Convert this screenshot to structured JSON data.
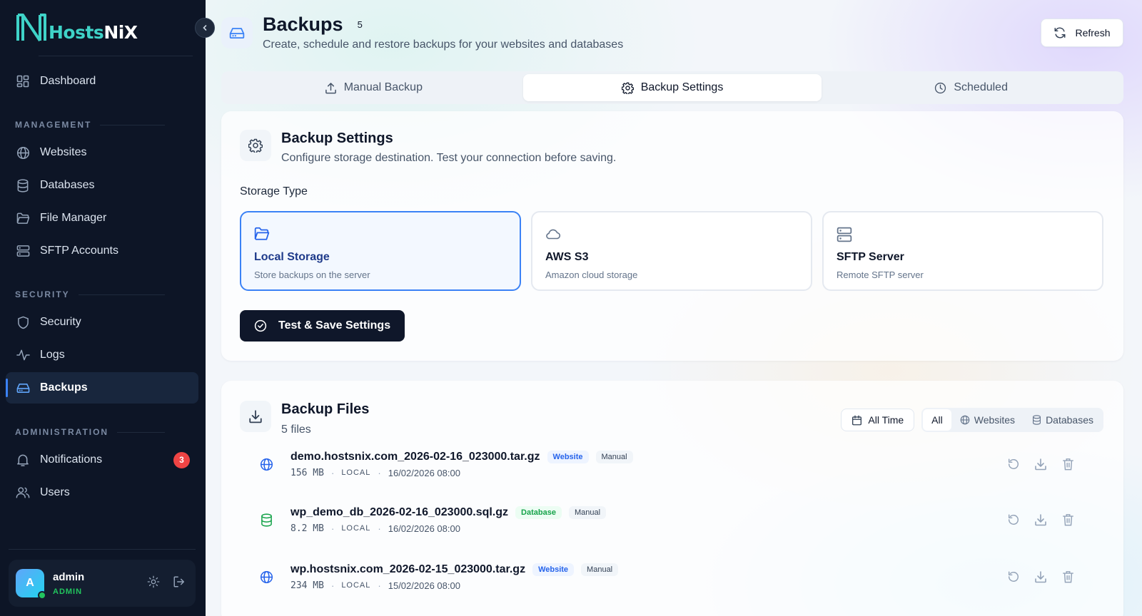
{
  "brand": {
    "name_part1": "Hosts",
    "name_part2": "NiX"
  },
  "sidebar": {
    "dashboard": {
      "label": "Dashboard"
    },
    "sections": {
      "management": "MANAGEMENT",
      "security": "SECURITY",
      "administration": "ADMINISTRATION"
    },
    "items": {
      "websites": "Websites",
      "databases": "Databases",
      "file_manager": "File Manager",
      "sftp_accounts": "SFTP Accounts",
      "security": "Security",
      "logs": "Logs",
      "backups": "Backups",
      "notifications": "Notifications",
      "users": "Users"
    },
    "notifications_count": "3",
    "user": {
      "initial": "A",
      "name": "admin",
      "role": "ADMIN"
    }
  },
  "header": {
    "title": "Backups",
    "count": "5",
    "subtitle": "Create, schedule and restore backups for your websites and databases",
    "refresh_label": "Refresh"
  },
  "tabs": {
    "manual": "Manual Backup",
    "settings": "Backup Settings",
    "scheduled": "Scheduled",
    "active": "settings"
  },
  "settings_card": {
    "title": "Backup Settings",
    "description": "Configure storage destination. Test your connection before saving.",
    "storage_type_label": "Storage Type",
    "options": [
      {
        "title": "Local Storage",
        "desc": "Store backups on the server",
        "icon": "folder-open-icon",
        "selected": true
      },
      {
        "title": "AWS S3",
        "desc": "Amazon cloud storage",
        "icon": "cloud-icon",
        "selected": false
      },
      {
        "title": "SFTP Server",
        "desc": "Remote SFTP server",
        "icon": "server-icon",
        "selected": false
      }
    ],
    "save_label": "Test & Save Settings"
  },
  "files_card": {
    "title": "Backup Files",
    "subtitle": "5 files",
    "filters": {
      "date": "All Time",
      "all": "All",
      "websites": "Websites",
      "databases": "Databases",
      "active": "all"
    },
    "files": [
      {
        "name": "demo.hostsnix.com_2026-02-16_023000.tar.gz",
        "type": "Website",
        "mode": "Manual",
        "size": "156 MB",
        "location": "LOCAL",
        "date": "16/02/2026 08:00"
      },
      {
        "name": "wp_demo_db_2026-02-16_023000.sql.gz",
        "type": "Database",
        "mode": "Manual",
        "size": "8.2 MB",
        "location": "LOCAL",
        "date": "16/02/2026 08:00"
      },
      {
        "name": "wp.hostsnix.com_2026-02-15_023000.tar.gz",
        "type": "Website",
        "mode": "Manual",
        "size": "234 MB",
        "location": "LOCAL",
        "date": "15/02/2026 08:00"
      }
    ]
  },
  "colors": {
    "sidebar_bg": "#0d1526",
    "accent": "#3b82f6",
    "brand_teal": "#3fd3c8",
    "primary_button": "#0f172a",
    "website_badge": "#2563eb",
    "database_badge": "#16a34a",
    "notification_badge": "#ef4444"
  }
}
